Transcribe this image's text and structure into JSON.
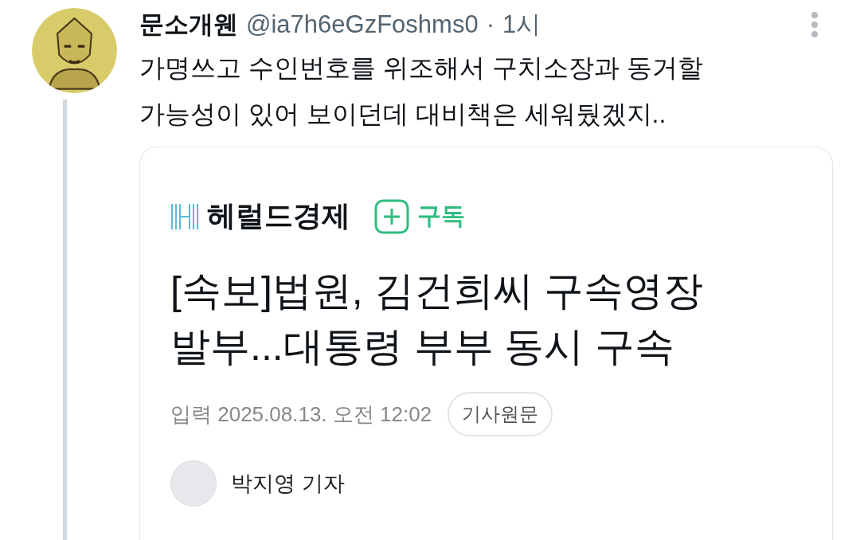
{
  "tweet": {
    "author": "문소개웬",
    "handle": "@ia7h6eGzFoshms0",
    "separator": "·",
    "time": "1시",
    "text_lines": [
      "가명쓰고 수인번호를 위조해서 구치소장과 동거할",
      "가능성이 있어 보이던데 대비책은 세워뒀겠지.."
    ]
  },
  "article": {
    "publisher": "헤럴드경제",
    "subscribe_label": "구독",
    "headline_lines": [
      "[속보]법원, 김건희씨 구속영장",
      "발부...대통령 부부 동시 구속"
    ],
    "date": "입력 2025.08.13. 오전 12:02",
    "original_button": "기사원문",
    "reporter": "박지영 기자"
  }
}
